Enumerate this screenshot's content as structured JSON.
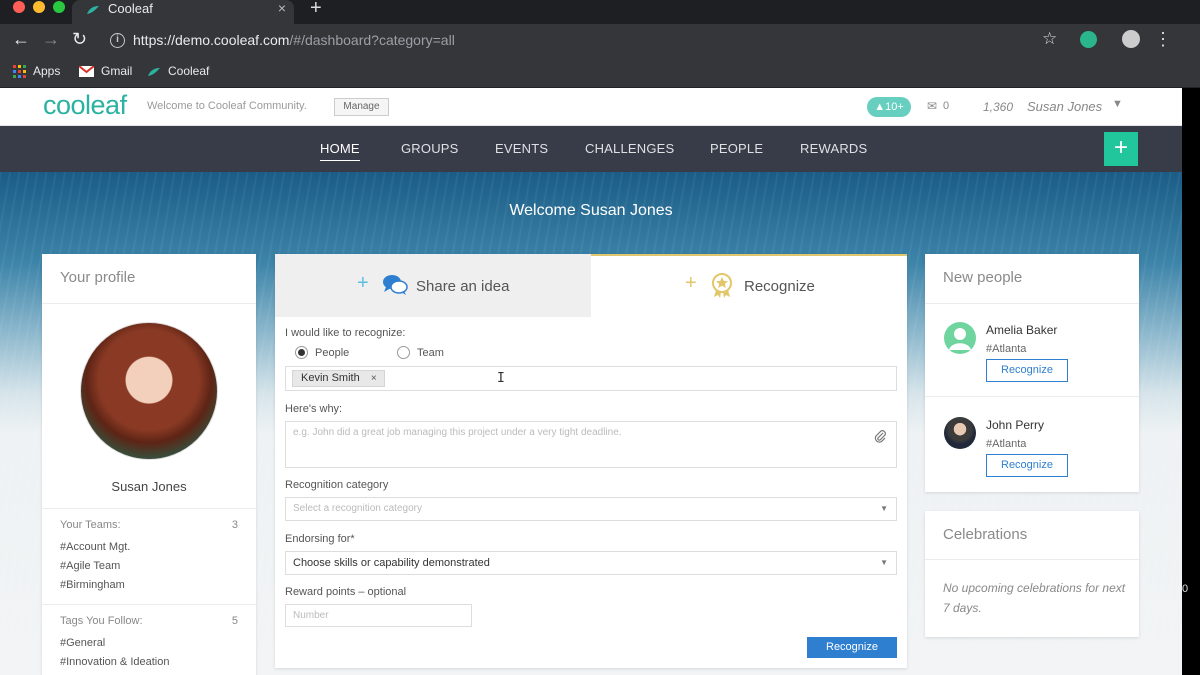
{
  "browser": {
    "tab_title": "Cooleaf",
    "tab_close": "×",
    "new_tab": "+",
    "url_host": "https://demo.cooleaf.com",
    "url_path": "/#/dashboard?category=all",
    "bookmarks": [
      {
        "label": "Apps",
        "icon": "apps-grid-icon"
      },
      {
        "label": "Gmail",
        "icon": "gmail-icon"
      },
      {
        "label": "Cooleaf",
        "icon": "cooleaf-icon"
      }
    ]
  },
  "header": {
    "logo": "cooleaf",
    "welcome": "Welcome to Cooleaf Community.",
    "manage": "Manage",
    "notif_badge": "10+",
    "mail_count": "0",
    "points": "1,360",
    "user_name": "Susan Jones"
  },
  "nav": {
    "items": [
      "HOME",
      "GROUPS",
      "EVENTS",
      "CHALLENGES",
      "PEOPLE",
      "REWARDS"
    ],
    "active": "HOME",
    "add_label": "+"
  },
  "hero": {
    "title": "Welcome Susan Jones"
  },
  "profile": {
    "title": "Your profile",
    "name": "Susan Jones",
    "teams_label": "Your Teams:",
    "teams_count": "3",
    "teams": [
      "#Account Mgt.",
      "#Agile Team",
      "#Birmingham"
    ],
    "tags_label": "Tags You Follow:",
    "tags_count": "5",
    "tags": [
      "#General",
      "#Innovation & Ideation"
    ]
  },
  "recognize": {
    "tab_share": "Share an idea",
    "tab_recognize": "Recognize",
    "who_label": "I would like to recognize:",
    "radio_people": "People",
    "radio_team": "Team",
    "chip_name": "Kevin Smith",
    "chip_remove": "×",
    "why_label": "Here's why:",
    "why_placeholder": "e.g. John did a great job managing this project under a very tight deadline.",
    "category_label": "Recognition category",
    "category_placeholder": "Select a recognition category",
    "endorsing_label": "Endorsing for*",
    "endorsing_value": "Choose skills or capability demonstrated",
    "points_label": "Reward points – optional",
    "points_placeholder": "Number",
    "submit": "Recognize"
  },
  "new_people": {
    "title": "New people",
    "people": [
      {
        "name": "Amelia Baker",
        "location": "#Atlanta",
        "button": "Recognize"
      },
      {
        "name": "John Perry",
        "location": "#Atlanta",
        "button": "Recognize"
      }
    ]
  },
  "celebrations": {
    "title": "Celebrations",
    "empty_text": "No upcoming celebrations for next 7 days."
  },
  "side_digit": "0",
  "colors": {
    "brand": "#2bb2a0",
    "nav_bg": "#383c49",
    "accent_button": "#21c69c",
    "primary_blue": "#2f7fd1"
  }
}
